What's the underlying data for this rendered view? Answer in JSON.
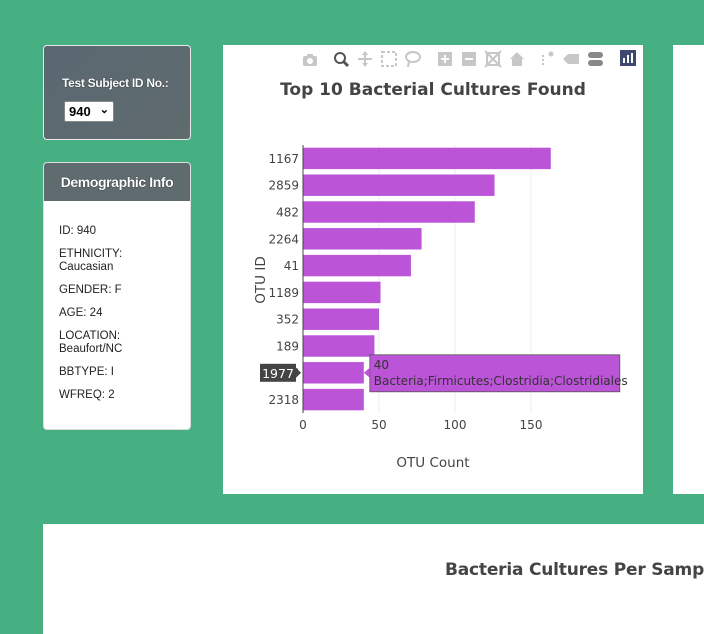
{
  "colors": {
    "background": "#47b083",
    "panel_dark": "#5f6b6e",
    "bar": "#bb54d6",
    "hover_bg": "#bb54d6",
    "hover_label_bg": "#444444"
  },
  "select_panel": {
    "label": "Test Subject ID No.:",
    "selected_value": "940",
    "chevron": "⌄"
  },
  "demographic_panel": {
    "title": "Demographic Info",
    "items": [
      "ID: 940",
      "ETHNICITY:\nCaucasian",
      "GENDER: F",
      "AGE: 24",
      "LOCATION:\nBeaufort/NC",
      "BBTYPE: I",
      "WFREQ: 2"
    ]
  },
  "modebar": {
    "icons": [
      "camera-icon",
      "zoom-icon",
      "pan-icon",
      "box-select-icon",
      "lasso-icon",
      "zoom-in-icon",
      "zoom-out-icon",
      "autoscale-icon",
      "home-icon",
      "spike-lines-icon",
      "hover-closest-icon",
      "hover-compare-icon",
      "plotly-logo-icon"
    ]
  },
  "chart_data": {
    "type": "bar",
    "orientation": "horizontal",
    "title": "Top 10 Bacterial Cultures Found",
    "xlabel": "OTU Count",
    "ylabel": "OTU ID",
    "categories": [
      "1167",
      "2859",
      "482",
      "2264",
      "41",
      "1189",
      "352",
      "189",
      "1977",
      "2318"
    ],
    "values": [
      163,
      126,
      113,
      78,
      71,
      51,
      50,
      47,
      40,
      40
    ],
    "xlim": [
      0,
      200
    ],
    "xticks": [
      0,
      50,
      100,
      150
    ],
    "grid": true,
    "hover": {
      "category": "1977",
      "value_text": "40",
      "label_text": "Bacteria;Firmicutes;Clostridia;Clostridiales"
    }
  },
  "bottom_panel": {
    "title": "Bacteria Cultures Per Sample"
  }
}
